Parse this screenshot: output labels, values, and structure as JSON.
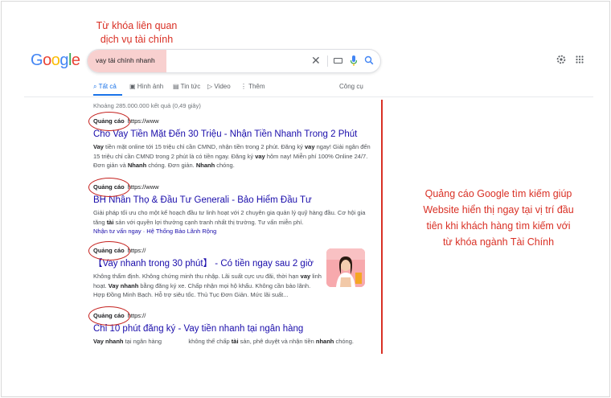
{
  "annotation_top": [
    "Từ khóa liên quan",
    "dịch vụ tài chính"
  ],
  "annotation_right": [
    "Quảng cáo Google tìm kiếm giúp",
    "Website hiển thị ngay tại vị trí đầu",
    "tiên khi khách hàng tìm kiếm với",
    "từ khóa ngành Tài Chính"
  ],
  "logo_letters": [
    {
      "ch": "G",
      "color": "#4285F4"
    },
    {
      "ch": "o",
      "color": "#EA4335"
    },
    {
      "ch": "o",
      "color": "#FBBC05"
    },
    {
      "ch": "g",
      "color": "#4285F4"
    },
    {
      "ch": "l",
      "color": "#34A853"
    },
    {
      "ch": "e",
      "color": "#EA4335"
    }
  ],
  "search": {
    "query": "vay tài chính nhanh",
    "clear_glyph": "✕"
  },
  "tabs": {
    "all": "Tất cả",
    "images": "Hình ảnh",
    "news": "Tin tức",
    "videos": "Video",
    "more": "Thêm",
    "tools": "Công cụ"
  },
  "stats": "Khoảng 285.000.000 kết quả (0,49 giây)",
  "ads": [
    {
      "label": "Quảng cáo",
      "url": "https://www",
      "title": "Cho Vay Tiền Mặt Đến 30 Triệu - Nhận Tiền Nhanh Trong 2 Phút",
      "desc_html": "<b>Vay</b> tiền mặt online tới 15 triệu chỉ cần CMND, nhận tiền trong 2 phút. Đăng ký <b>vay</b> ngay! Giải ngân đến 15 triệu chỉ cần CMND trong 2 phút là có tiền ngay. Đăng ký <b>vay</b> hôm nay! Miễn phí 100% Online 24/7. Đơn giản và <b>Nhanh</b> chóng. Đơn giản. <b>Nhanh</b> chóng."
    },
    {
      "label": "Quảng cáo",
      "url": "https://www",
      "title": "BH Nhân Thọ & Đầu Tư Generali - Bảo Hiểm Đầu Tư",
      "desc_html": "Giải pháp tối ưu cho một kế hoạch đầu tư linh hoạt với 2 chuyên gia quản lý quỹ hàng đầu. Cơ hội gia tăng <b>tài</b> sản với quyền lợi thưởng cạnh tranh nhất thị trường. Tư vấn miễn phí.",
      "sitelinks": "Nhận tư vấn ngay · Hệ Thống Bảo Lãnh Rộng"
    },
    {
      "label": "Quảng cáo",
      "url": "https://",
      "title": "【Vay nhanh trong 30 phút】 - Có tiền ngay sau 2 giờ",
      "desc_html": "Không thẩm định. Không chứng minh thu nhập. Lãi suất cực ưu đãi, thời hạn <b>vay</b> linh hoạt. <b>Vay nhanh</b> bằng đăng ký xe. Chấp nhận mọi hộ khẩu. Không cần bảo lãnh. Hợp Đồng Minh Bạch. Hỗ trợ siêu tốc. Thủ Tục Đơn Giản. Mức lãi suất..."
    },
    {
      "label": "Quảng cáo",
      "url": "https://",
      "title": "Chỉ 10 phút đăng ký - Vay tiền nhanh tại ngân hàng",
      "desc_html": "<b>Vay nhanh</b> tại ngân hàng &nbsp;&nbsp;&nbsp;&nbsp;&nbsp;&nbsp;&nbsp;&nbsp;&nbsp;&nbsp;&nbsp;&nbsp;&nbsp;&nbsp; không thế chấp <b>tài</b> sản, phê duyệt và nhận tiền <b>nhanh</b> chóng."
    }
  ],
  "colors": {
    "accent": "#1a73e8",
    "annotation": "#d93025",
    "link": "#1a0dab"
  }
}
